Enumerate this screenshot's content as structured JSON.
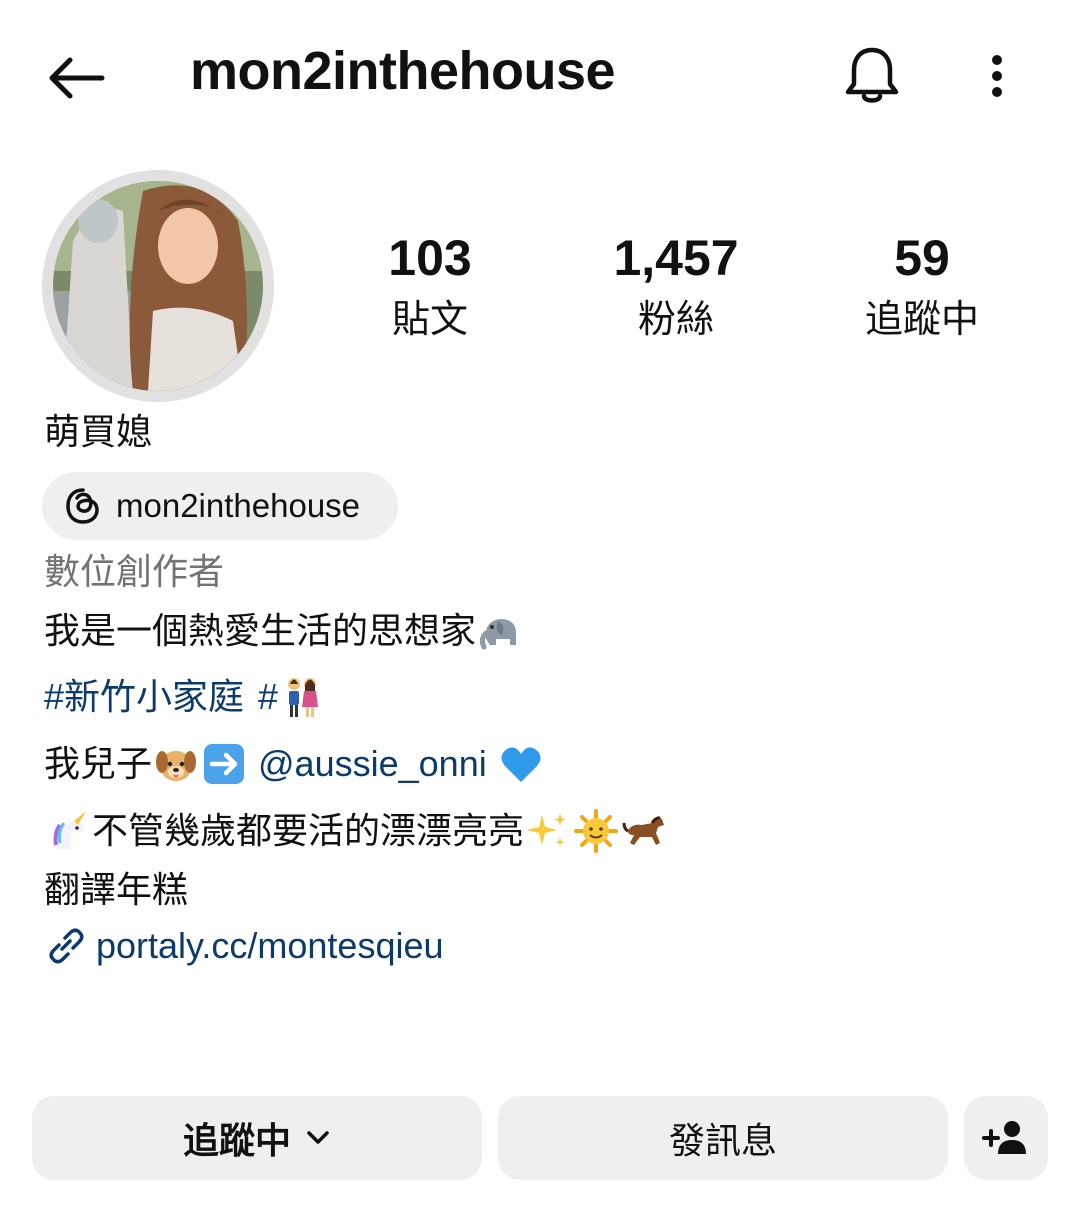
{
  "header": {
    "title": "mon2inthehouse",
    "back_icon": "arrow-left-icon",
    "bell_icon": "bell-icon",
    "more_icon": "more-vertical-icon"
  },
  "profile": {
    "stats": [
      {
        "value": "103",
        "label": "貼文"
      },
      {
        "value": "1,457",
        "label": "粉絲"
      },
      {
        "value": "59",
        "label": "追蹤中"
      }
    ],
    "display_name": "萌買媳",
    "threads_handle": "mon2inthehouse",
    "category": "數位創作者",
    "bio": {
      "line1": "我是一個熱愛生活的思想家",
      "line2_hashtag1": "#新竹小家庭",
      "line2_hashtag2": "#",
      "line3_prefix": "我兒子",
      "line3_mention": "@aussie_onni",
      "line4": "不管幾歲都要活的漂漂亮亮",
      "line5": "翻譯年糕"
    },
    "link": "portaly.cc/montesqieu"
  },
  "actions": {
    "following_label": "追蹤中",
    "message_label": "發訊息",
    "add_user_icon": "add-user-icon"
  },
  "colors": {
    "link": "#0b3a6b",
    "secondary_text": "#737373",
    "button_bg": "#efefef",
    "avatar_ring": "#e1e1e1"
  }
}
